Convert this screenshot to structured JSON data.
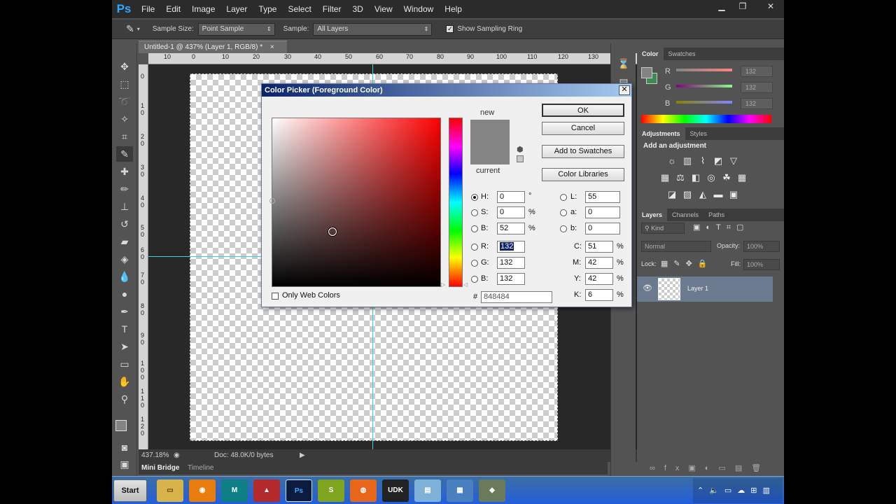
{
  "menubar": {
    "logo": "Ps",
    "items": [
      "File",
      "Edit",
      "Image",
      "Layer",
      "Type",
      "Select",
      "Filter",
      "3D",
      "View",
      "Window",
      "Help"
    ]
  },
  "options": {
    "sample_size_label": "Sample Size:",
    "sample_size_value": "Point Sample",
    "sample_label": "Sample:",
    "sample_value": "All Layers",
    "show_ring_label": "Show Sampling Ring"
  },
  "document": {
    "tab_title": "Untitled-1 @ 437% (Layer 1, RGB/8) *",
    "ruler_top": [
      "10",
      "0",
      "10",
      "20",
      "30",
      "40",
      "50",
      "60",
      "70",
      "80",
      "90",
      "100",
      "110",
      "120",
      "130"
    ],
    "ruler_left": [
      "0",
      "1 0",
      "2 0",
      "3 0",
      "4 0",
      "5 0",
      "6 0",
      "7 0",
      "8 0",
      "9 0",
      "1 0 0",
      "1 1 0",
      "1 2 0"
    ],
    "zoom": "437.18%",
    "doc_info": "Doc: 48.0K/0 bytes"
  },
  "bottom_tabs": [
    "Mini Bridge",
    "Timeline"
  ],
  "panels": {
    "color_tabs": [
      "Color",
      "Swatches"
    ],
    "rgb": [
      {
        "label": "R",
        "value": "132"
      },
      {
        "label": "G",
        "value": "132"
      },
      {
        "label": "B",
        "value": "132"
      }
    ],
    "adjustments_tabs": [
      "Adjustments",
      "Styles"
    ],
    "add_adjustment": "Add an adjustment",
    "layers_tabs": [
      "Layers",
      "Channels",
      "Paths"
    ],
    "kind_label": "Kind",
    "blend_mode": "Normal",
    "opacity_label": "Opacity:",
    "opacity_value": "100%",
    "lock_label": "Lock:",
    "fill_label": "Fill:",
    "fill_value": "100%",
    "layer_name": "Layer 1"
  },
  "dialog": {
    "title": "Color Picker (Foreground Color)",
    "new_label": "new",
    "current_label": "current",
    "ok": "OK",
    "cancel": "Cancel",
    "add_swatches": "Add to Swatches",
    "color_libraries": "Color Libraries",
    "hsb": [
      {
        "label": "H:",
        "value": "0",
        "unit": "°"
      },
      {
        "label": "S:",
        "value": "0",
        "unit": "%"
      },
      {
        "label": "B:",
        "value": "52",
        "unit": "%"
      }
    ],
    "rgb": [
      {
        "label": "R:",
        "value": "132"
      },
      {
        "label": "G:",
        "value": "132"
      },
      {
        "label": "B:",
        "value": "132"
      }
    ],
    "lab": [
      {
        "label": "L:",
        "value": "55"
      },
      {
        "label": "a:",
        "value": "0"
      },
      {
        "label": "b:",
        "value": "0"
      }
    ],
    "cmyk": [
      {
        "label": "C:",
        "value": "51",
        "unit": "%"
      },
      {
        "label": "M:",
        "value": "42",
        "unit": "%"
      },
      {
        "label": "Y:",
        "value": "42",
        "unit": "%"
      },
      {
        "label": "K:",
        "value": "6",
        "unit": "%"
      }
    ],
    "hex_label": "#",
    "hex_value": "848484",
    "only_web_colors": "Only Web Colors",
    "color_hex": "#848484"
  },
  "taskbar": {
    "start": "Start",
    "apps": [
      "Folder",
      "Blender",
      "Maya",
      "Mudbox",
      "Ps",
      "Shell",
      "Firefox",
      "UDK",
      "Notes",
      "Network",
      "Tool"
    ]
  }
}
